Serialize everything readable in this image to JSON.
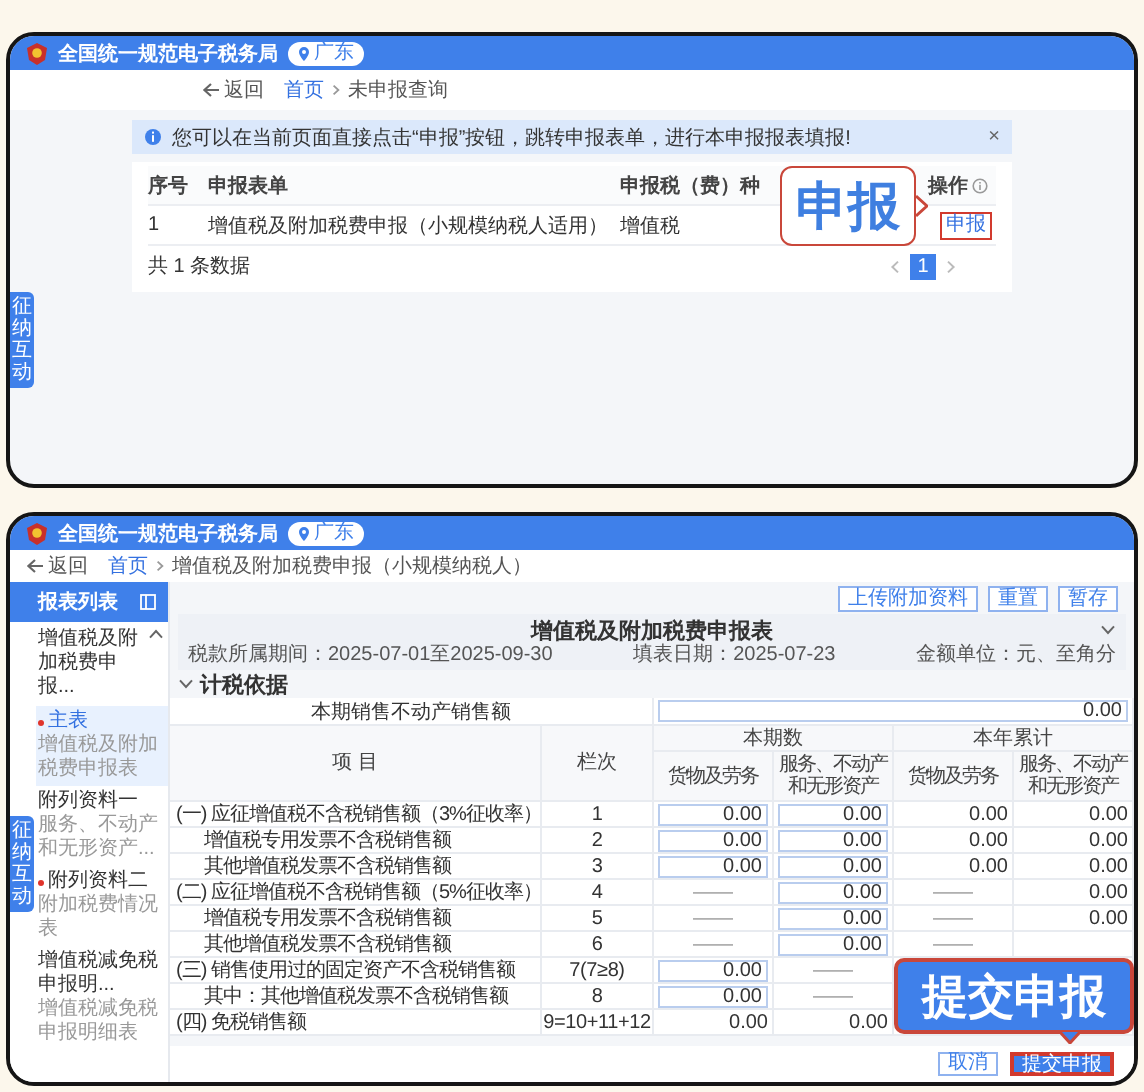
{
  "query_screen": {
    "header": {
      "site_title": "全国统一规范电子税务局",
      "region": "广东"
    },
    "back": "返回",
    "breadcrumb": [
      "首页",
      "未申报查询"
    ],
    "notice": {
      "text": "您可以在当前页面直接点击“申报”按钮，跳转申报表单，进行本申报报表填报!",
      "close": "×"
    },
    "table": {
      "columns": [
        "序号",
        "申报表单",
        "申报税（费）种",
        "操作"
      ],
      "rows": [
        {
          "index": "1",
          "form": "增值税及附加税费申报（小规模纳税人适用）",
          "tax": "增值税",
          "action": "申报",
          "highlighted": true
        }
      ],
      "total": "共 1 条数据",
      "pages": [
        {
          "label": "1",
          "selected": true
        }
      ]
    },
    "callout": "申报",
    "side_tab": "征纳互动"
  },
  "form_screen": {
    "header": {
      "site_title": "全国统一规范电子税务局",
      "region": "广东"
    },
    "back": "返回",
    "breadcrumb": [
      "首页",
      "增值税及附加税费申报（小规模纳税人）"
    ],
    "sidebar": {
      "title": "报表列表",
      "group": {
        "label": "增值税及附加税费申报...",
        "expanded": true
      },
      "items": [
        {
          "title": "主表",
          "subtitle": "增值税及附加税费申报表",
          "required": true,
          "selected": true
        },
        {
          "title": "附列资料一",
          "subtitle": "服务、不动产和无形资产...",
          "required": false,
          "selected": false
        },
        {
          "title": "附列资料二",
          "subtitle": "附加税费情况表",
          "required": true,
          "selected": false
        },
        {
          "title": "增值税减免税申报明...",
          "subtitle": "增值税减免税申报明细表",
          "required": false,
          "selected": false
        }
      ]
    },
    "toolbar": [
      "上传附加资料",
      "重置",
      "暂存"
    ],
    "form": {
      "title": "增值税及附加税费申报表",
      "period": "税款所属期间：2025-07-01至2025-09-30",
      "fill_date": "填表日期：2025-07-23",
      "unit": "金额单位：元、至角分"
    },
    "section": {
      "title": "计税依据",
      "expanded": true
    },
    "table": {
      "lead_row": {
        "label": "本期销售不动产销售额",
        "value": "0.00"
      },
      "item_header": "项 目",
      "line_header": "栏次",
      "groups": [
        {
          "label": "本期数",
          "columns": [
            "货物及劳务",
            "服务、不动产和无形资产"
          ]
        },
        {
          "label": "本年累计",
          "columns": [
            "货物及劳务",
            "服务、不动产和无形资产"
          ]
        }
      ],
      "rows": [
        {
          "label": "(一) 应征增值税不含税销售额（3%征收率）",
          "line": "1",
          "cells": [
            {
              "kind": "input",
              "value": "0.00"
            },
            {
              "kind": "input",
              "value": "0.00"
            },
            {
              "kind": "text",
              "value": "0.00"
            },
            {
              "kind": "text",
              "value": "0.00"
            }
          ],
          "children": [
            {
              "label": "增值税专用发票不含税销售额",
              "line": "2",
              "cells": [
                {
                  "kind": "input",
                  "value": "0.00"
                },
                {
                  "kind": "input",
                  "value": "0.00"
                },
                {
                  "kind": "text",
                  "value": "0.00"
                },
                {
                  "kind": "text",
                  "value": "0.00"
                }
              ]
            },
            {
              "label": "其他增值税发票不含税销售额",
              "line": "3",
              "cells": [
                {
                  "kind": "input",
                  "value": "0.00"
                },
                {
                  "kind": "input",
                  "value": "0.00"
                },
                {
                  "kind": "text",
                  "value": "0.00"
                },
                {
                  "kind": "text",
                  "value": "0.00"
                }
              ]
            }
          ]
        },
        {
          "label": "(二) 应征增值税不含税销售额（5%征收率）",
          "line": "4",
          "cells": [
            {
              "kind": "dash",
              "value": "——"
            },
            {
              "kind": "input",
              "value": "0.00"
            },
            {
              "kind": "dash",
              "value": "——"
            },
            {
              "kind": "text",
              "value": "0.00"
            }
          ],
          "children": [
            {
              "label": "增值税专用发票不含税销售额",
              "line": "5",
              "cells": [
                {
                  "kind": "dash",
                  "value": "——"
                },
                {
                  "kind": "input",
                  "value": "0.00"
                },
                {
                  "kind": "dash",
                  "value": "——"
                },
                {
                  "kind": "text",
                  "value": "0.00"
                }
              ]
            },
            {
              "label": "其他增值税发票不含税销售额",
              "line": "6",
              "cells": [
                {
                  "kind": "dash",
                  "value": "——"
                },
                {
                  "kind": "input",
                  "value": "0.00"
                },
                {
                  "kind": "dash",
                  "value": "——"
                }
              ]
            }
          ]
        },
        {
          "label": "(三) 销售使用过的固定资产不含税销售额",
          "line": "7(7≥8)",
          "cells": [
            {
              "kind": "input",
              "value": "0.00"
            },
            {
              "kind": "dash",
              "value": "——"
            }
          ],
          "children": [
            {
              "label": "其中：其他增值税发票不含税销售额",
              "line": "8",
              "cells": [
                {
                  "kind": "input",
                  "value": "0.00"
                },
                {
                  "kind": "dash",
                  "value": "——"
                }
              ]
            }
          ]
        },
        {
          "label": "(四) 免税销售额",
          "line": "9=10+11+12",
          "cells": [
            {
              "kind": "text",
              "value": "0.00"
            },
            {
              "kind": "text",
              "value": "0.00"
            }
          ]
        }
      ]
    },
    "footer": [
      {
        "label": "取消",
        "kind": "secondary",
        "highlighted": false
      },
      {
        "label": "提交申报",
        "kind": "primary",
        "highlighted": true
      }
    ],
    "callout": "提交申报",
    "side_tab": "征纳互动"
  }
}
